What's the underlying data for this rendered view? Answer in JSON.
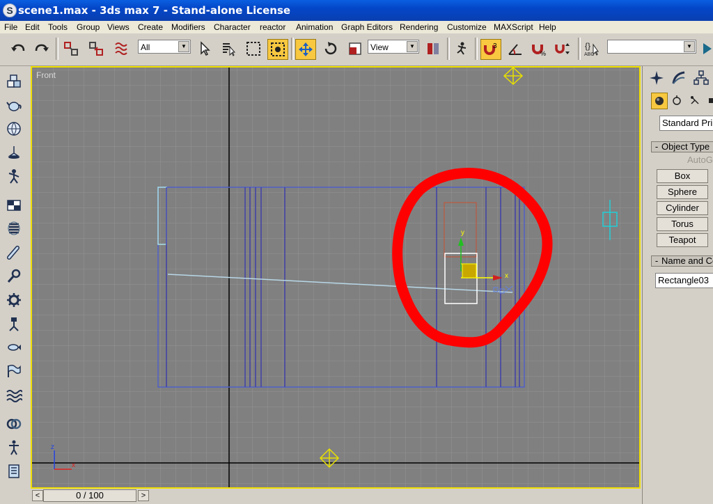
{
  "window": {
    "icon_letter": "S",
    "title": "scene1.max - 3ds max 7  - Stand-alone License"
  },
  "menu": [
    "File",
    "Edit",
    "Tools",
    "Group",
    "Views",
    "Create",
    "Modifiers",
    "Character",
    "reactor",
    "Animation",
    "Graph Editors",
    "Rendering",
    "Customize",
    "MAXScript",
    "Help"
  ],
  "toolbar": {
    "selection_filter": "All",
    "reference_coordinate": "View",
    "snaps_toggle_label": "3",
    "named_selection_set": "",
    "named_sets_label": "ABC"
  },
  "viewport": {
    "label": "Front",
    "axis_z": "z",
    "axis_x": "x",
    "gizmo_y": "y",
    "gizmo_x": "x",
    "grid_color": "#949494",
    "background_color": "#808080",
    "selection_color": "#ffffff",
    "wire_color": "#4040a8",
    "highlight_circle_color": "#ff0000"
  },
  "command_panel": {
    "primitive_type": "Standard Primitives",
    "object_type_header": "Object Type",
    "autogrid_label": "AutoGrid",
    "buttons": [
      "Box",
      "Sphere",
      "Cylinder",
      "Torus",
      "Teapot"
    ],
    "name_color_header": "Name and Color",
    "object_name": "Rectangle03"
  },
  "timeline": {
    "frame_display": "0 / 100",
    "prev_label": "<",
    "next_label": ">"
  }
}
